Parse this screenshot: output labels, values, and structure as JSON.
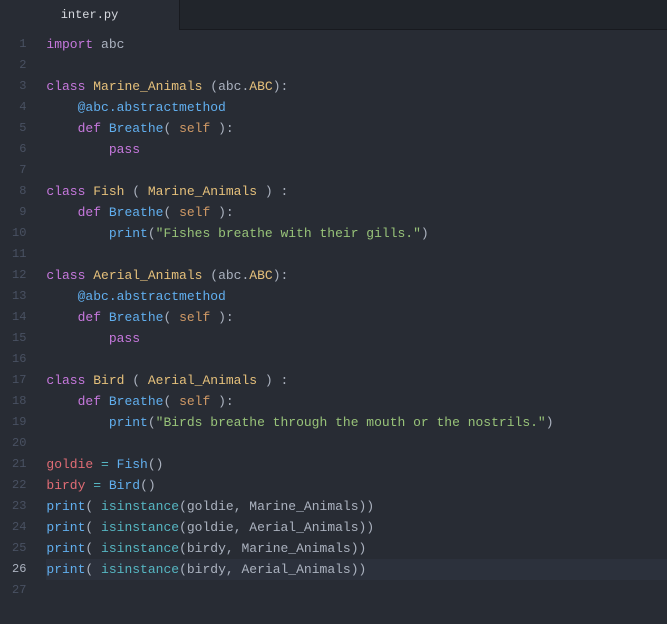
{
  "tab": {
    "filename": "inter.py"
  },
  "editor": {
    "cursor_line": 26,
    "lines": [
      {
        "n": 1,
        "tokens": [
          {
            "c": "kw",
            "t": "import"
          },
          {
            "c": "plain",
            "t": " abc"
          }
        ]
      },
      {
        "n": 2,
        "tokens": []
      },
      {
        "n": 3,
        "tokens": [
          {
            "c": "kw",
            "t": "class"
          },
          {
            "c": "plain",
            "t": " "
          },
          {
            "c": "cls",
            "t": "Marine_Animals"
          },
          {
            "c": "plain",
            "t": " ("
          },
          {
            "c": "plain",
            "t": "abc"
          },
          {
            "c": "punc",
            "t": "."
          },
          {
            "c": "cls",
            "t": "ABC"
          },
          {
            "c": "plain",
            "t": "):"
          }
        ]
      },
      {
        "n": 4,
        "tokens": [
          {
            "c": "plain",
            "t": "    "
          },
          {
            "c": "fn",
            "t": "@abc.abstractmethod"
          }
        ]
      },
      {
        "n": 5,
        "tokens": [
          {
            "c": "plain",
            "t": "    "
          },
          {
            "c": "kw",
            "t": "def"
          },
          {
            "c": "plain",
            "t": " "
          },
          {
            "c": "fn",
            "t": "Breathe"
          },
          {
            "c": "punc",
            "t": "("
          },
          {
            "c": "plain",
            "t": " "
          },
          {
            "c": "param",
            "t": "self"
          },
          {
            "c": "plain",
            "t": " "
          },
          {
            "c": "punc",
            "t": "):"
          }
        ]
      },
      {
        "n": 6,
        "tokens": [
          {
            "c": "plain",
            "t": "        "
          },
          {
            "c": "kw",
            "t": "pass"
          }
        ]
      },
      {
        "n": 7,
        "tokens": []
      },
      {
        "n": 8,
        "tokens": [
          {
            "c": "kw",
            "t": "class"
          },
          {
            "c": "plain",
            "t": " "
          },
          {
            "c": "cls",
            "t": "Fish"
          },
          {
            "c": "plain",
            "t": " ( "
          },
          {
            "c": "cls",
            "t": "Marine_Animals"
          },
          {
            "c": "plain",
            "t": " ) :"
          }
        ]
      },
      {
        "n": 9,
        "tokens": [
          {
            "c": "plain",
            "t": "    "
          },
          {
            "c": "kw",
            "t": "def"
          },
          {
            "c": "plain",
            "t": " "
          },
          {
            "c": "fn",
            "t": "Breathe"
          },
          {
            "c": "punc",
            "t": "("
          },
          {
            "c": "plain",
            "t": " "
          },
          {
            "c": "param",
            "t": "self"
          },
          {
            "c": "plain",
            "t": " "
          },
          {
            "c": "punc",
            "t": "):"
          }
        ]
      },
      {
        "n": 10,
        "tokens": [
          {
            "c": "plain",
            "t": "        "
          },
          {
            "c": "fn",
            "t": "print"
          },
          {
            "c": "punc",
            "t": "("
          },
          {
            "c": "str",
            "t": "\"Fishes breathe with their gills.\""
          },
          {
            "c": "punc",
            "t": ")"
          }
        ]
      },
      {
        "n": 11,
        "tokens": []
      },
      {
        "n": 12,
        "tokens": [
          {
            "c": "kw",
            "t": "class"
          },
          {
            "c": "plain",
            "t": " "
          },
          {
            "c": "cls",
            "t": "Aerial_Animals"
          },
          {
            "c": "plain",
            "t": " ("
          },
          {
            "c": "plain",
            "t": "abc"
          },
          {
            "c": "punc",
            "t": "."
          },
          {
            "c": "cls",
            "t": "ABC"
          },
          {
            "c": "plain",
            "t": "):"
          }
        ]
      },
      {
        "n": 13,
        "tokens": [
          {
            "c": "plain",
            "t": "    "
          },
          {
            "c": "fn",
            "t": "@abc.abstractmethod"
          }
        ]
      },
      {
        "n": 14,
        "tokens": [
          {
            "c": "plain",
            "t": "    "
          },
          {
            "c": "kw",
            "t": "def"
          },
          {
            "c": "plain",
            "t": " "
          },
          {
            "c": "fn",
            "t": "Breathe"
          },
          {
            "c": "punc",
            "t": "("
          },
          {
            "c": "plain",
            "t": " "
          },
          {
            "c": "param",
            "t": "self"
          },
          {
            "c": "plain",
            "t": " "
          },
          {
            "c": "punc",
            "t": "):"
          }
        ]
      },
      {
        "n": 15,
        "tokens": [
          {
            "c": "plain",
            "t": "        "
          },
          {
            "c": "kw",
            "t": "pass"
          }
        ]
      },
      {
        "n": 16,
        "tokens": []
      },
      {
        "n": 17,
        "tokens": [
          {
            "c": "kw",
            "t": "class"
          },
          {
            "c": "plain",
            "t": " "
          },
          {
            "c": "cls",
            "t": "Bird"
          },
          {
            "c": "plain",
            "t": " ( "
          },
          {
            "c": "cls",
            "t": "Aerial_Animals"
          },
          {
            "c": "plain",
            "t": " ) :"
          }
        ]
      },
      {
        "n": 18,
        "tokens": [
          {
            "c": "plain",
            "t": "    "
          },
          {
            "c": "kw",
            "t": "def"
          },
          {
            "c": "plain",
            "t": " "
          },
          {
            "c": "fn",
            "t": "Breathe"
          },
          {
            "c": "punc",
            "t": "("
          },
          {
            "c": "plain",
            "t": " "
          },
          {
            "c": "param",
            "t": "self"
          },
          {
            "c": "plain",
            "t": " "
          },
          {
            "c": "punc",
            "t": "):"
          }
        ]
      },
      {
        "n": 19,
        "tokens": [
          {
            "c": "plain",
            "t": "        "
          },
          {
            "c": "fn",
            "t": "print"
          },
          {
            "c": "punc",
            "t": "("
          },
          {
            "c": "str",
            "t": "\"Birds breathe through the mouth or the nostrils.\""
          },
          {
            "c": "punc",
            "t": ")"
          }
        ]
      },
      {
        "n": 20,
        "tokens": []
      },
      {
        "n": 21,
        "tokens": [
          {
            "c": "ident",
            "t": "goldie"
          },
          {
            "c": "plain",
            "t": " "
          },
          {
            "c": "op",
            "t": "="
          },
          {
            "c": "plain",
            "t": " "
          },
          {
            "c": "fn",
            "t": "Fish"
          },
          {
            "c": "punc",
            "t": "()"
          }
        ]
      },
      {
        "n": 22,
        "tokens": [
          {
            "c": "ident",
            "t": "birdy"
          },
          {
            "c": "plain",
            "t": " "
          },
          {
            "c": "op",
            "t": "="
          },
          {
            "c": "plain",
            "t": " "
          },
          {
            "c": "fn",
            "t": "Bird"
          },
          {
            "c": "punc",
            "t": "()"
          }
        ]
      },
      {
        "n": 23,
        "tokens": [
          {
            "c": "fn",
            "t": "print"
          },
          {
            "c": "punc",
            "t": "("
          },
          {
            "c": "plain",
            "t": " "
          },
          {
            "c": "builtin",
            "t": "isinstance"
          },
          {
            "c": "punc",
            "t": "("
          },
          {
            "c": "plain",
            "t": "goldie"
          },
          {
            "c": "punc",
            "t": ","
          },
          {
            "c": "plain",
            "t": " Marine_Animals"
          },
          {
            "c": "punc",
            "t": "))"
          }
        ]
      },
      {
        "n": 24,
        "tokens": [
          {
            "c": "fn",
            "t": "print"
          },
          {
            "c": "punc",
            "t": "("
          },
          {
            "c": "plain",
            "t": " "
          },
          {
            "c": "builtin",
            "t": "isinstance"
          },
          {
            "c": "punc",
            "t": "("
          },
          {
            "c": "plain",
            "t": "goldie"
          },
          {
            "c": "punc",
            "t": ","
          },
          {
            "c": "plain",
            "t": " Aerial_Animals"
          },
          {
            "c": "punc",
            "t": "))"
          }
        ]
      },
      {
        "n": 25,
        "tokens": [
          {
            "c": "fn",
            "t": "print"
          },
          {
            "c": "punc",
            "t": "("
          },
          {
            "c": "plain",
            "t": " "
          },
          {
            "c": "builtin",
            "t": "isinstance"
          },
          {
            "c": "punc",
            "t": "("
          },
          {
            "c": "plain",
            "t": "birdy"
          },
          {
            "c": "punc",
            "t": ","
          },
          {
            "c": "plain",
            "t": " Marine_Animals"
          },
          {
            "c": "punc",
            "t": "))"
          }
        ]
      },
      {
        "n": 26,
        "tokens": [
          {
            "c": "fn",
            "t": "print"
          },
          {
            "c": "punc",
            "t": "("
          },
          {
            "c": "plain",
            "t": " "
          },
          {
            "c": "builtin",
            "t": "isinstance"
          },
          {
            "c": "punc",
            "t": "("
          },
          {
            "c": "plain",
            "t": "birdy"
          },
          {
            "c": "punc",
            "t": ","
          },
          {
            "c": "plain",
            "t": " Aerial_Animals"
          },
          {
            "c": "punc",
            "t": "))"
          }
        ]
      },
      {
        "n": 27,
        "tokens": []
      }
    ]
  }
}
